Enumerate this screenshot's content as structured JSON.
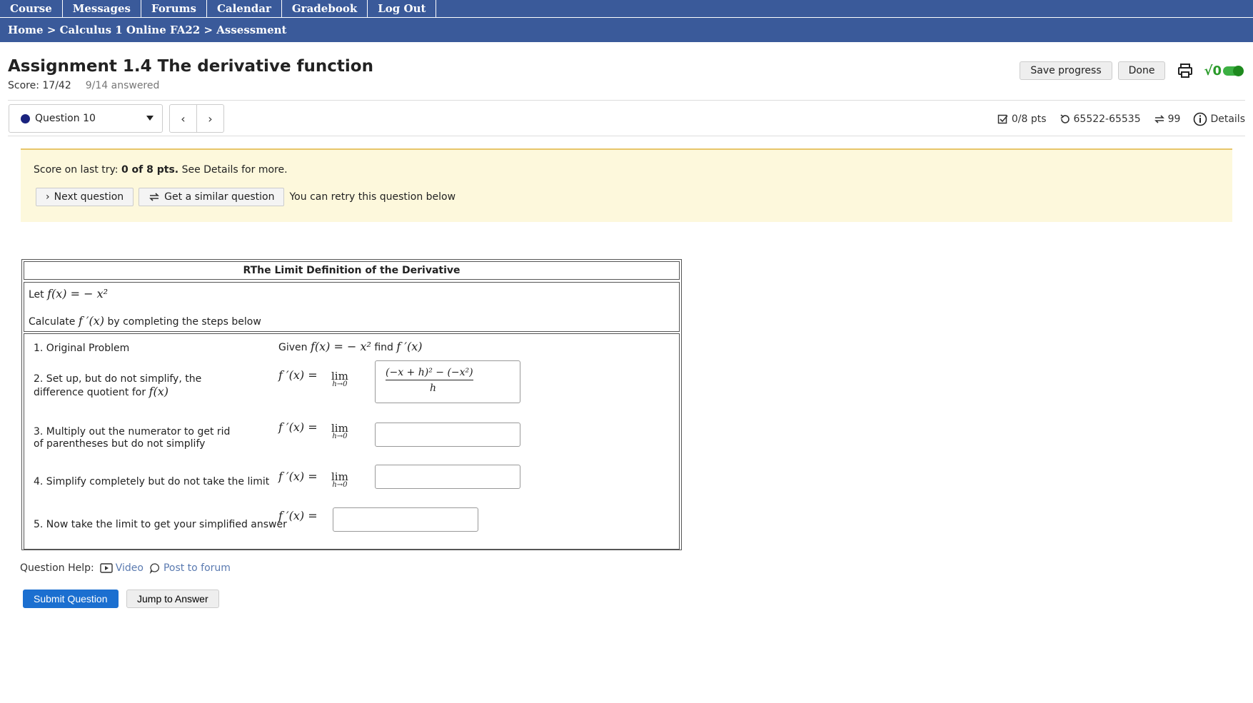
{
  "nav": [
    "Course",
    "Messages",
    "Forums",
    "Calendar",
    "Gradebook",
    "Log Out"
  ],
  "breadcrumb": "Home > Calculus 1 Online FA22 > Assessment",
  "assignment": {
    "title": "Assignment 1.4 The derivative function",
    "score": "Score: 17/42",
    "answered": "9/14 answered",
    "save_label": "Save progress",
    "done_label": "Done"
  },
  "question_nav": {
    "selected": "Question 10",
    "points": "0/8 pts",
    "seed": "65522-65535",
    "tries": "99",
    "details_label": "Details"
  },
  "banner": {
    "score_prefix": "Score on last try: ",
    "score_bold": "0 of 8 pts.",
    "score_suffix": " See Details for more.",
    "next_label": "Next question",
    "similar_label": "Get a similar question",
    "retry_text": "You can retry this question below"
  },
  "problem": {
    "title": "RThe Limit Definition of the Derivative",
    "let_prefix": "Let ",
    "let_math": "f(x) = − x²",
    "calc_prefix": "Calculate ",
    "calc_math": "f ′(x)",
    "calc_suffix": " by completing the steps below",
    "steps": [
      {
        "label": "1. Original Problem",
        "rhs_prefix": "Given ",
        "rhs_math1": "f(x) = − x²",
        "rhs_mid": " find ",
        "rhs_math2": "f ′(x)"
      },
      {
        "label": "2. Set up, but do not simplify, the difference quotient for ",
        "label_math": "f(x)",
        "answer_num": "(−x + h)² − (−x²)",
        "answer_den": "h"
      },
      {
        "label": "3. Multiply out the numerator to get rid of parentheses but do not simplify",
        "answer": ""
      },
      {
        "label": "4. Simplify completely but do not take the limit",
        "answer": ""
      },
      {
        "label": "5. Now take the limit to get your simplified answer",
        "answer": ""
      }
    ],
    "fprime": "f ′(x) =",
    "lim_word": "lim",
    "lim_sub": "h→0"
  },
  "help": {
    "label": "Question Help:",
    "video": "Video",
    "forum": "Post to forum"
  },
  "actions": {
    "submit": "Submit Question",
    "jump": "Jump to Answer"
  }
}
